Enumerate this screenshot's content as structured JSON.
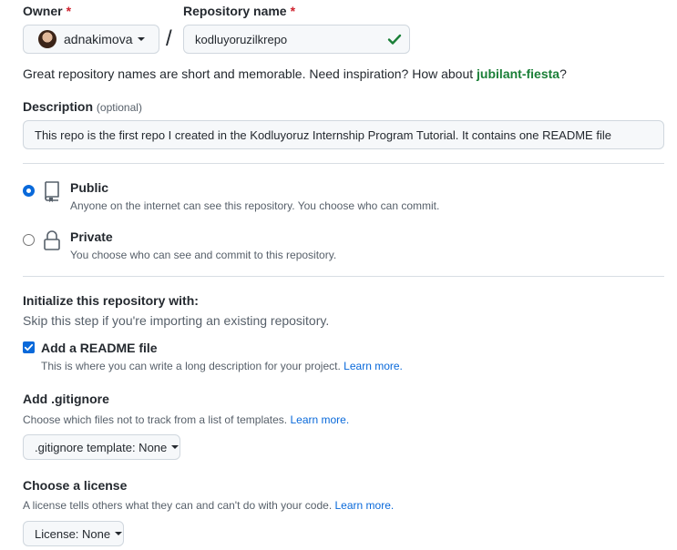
{
  "owner": {
    "label": "Owner",
    "required_mark": "*",
    "username": "adnakimova"
  },
  "separator": "/",
  "repo_name": {
    "label": "Repository name",
    "required_mark": "*",
    "value": "kodluyoruzilkrepo"
  },
  "hint": {
    "prefix": "Great repository names are short and memorable. Need inspiration? How about ",
    "suggestion": "jubilant-fiesta",
    "suffix": "?"
  },
  "description": {
    "label": "Description",
    "optional": "(optional)",
    "value": "This repo is the first repo I created in the Kodluyoruz Internship Program Tutorial. It contains one README file"
  },
  "visibility": {
    "public": {
      "label": "Public",
      "desc": "Anyone on the internet can see this repository. You choose who can commit.",
      "selected": true
    },
    "private": {
      "label": "Private",
      "desc": "You choose who can see and commit to this repository.",
      "selected": false
    }
  },
  "init": {
    "title": "Initialize this repository with:",
    "subtitle": "Skip this step if you're importing an existing repository.",
    "readme_label": "Add a README file",
    "readme_checked": true,
    "readme_desc": "This is where you can write a long description for your project.",
    "readme_link": "Learn more."
  },
  "gitignore": {
    "title": "Add .gitignore",
    "desc": "Choose which files not to track from a list of templates.",
    "link": "Learn more.",
    "button": ".gitignore template: None"
  },
  "license": {
    "title": "Choose a license",
    "desc": "A license tells others what they can and can't do with your code.",
    "link": "Learn more.",
    "button": "License: None"
  },
  "colors": {
    "accent": "#0969da",
    "success": "#1a7f37",
    "danger": "#cf222e"
  }
}
